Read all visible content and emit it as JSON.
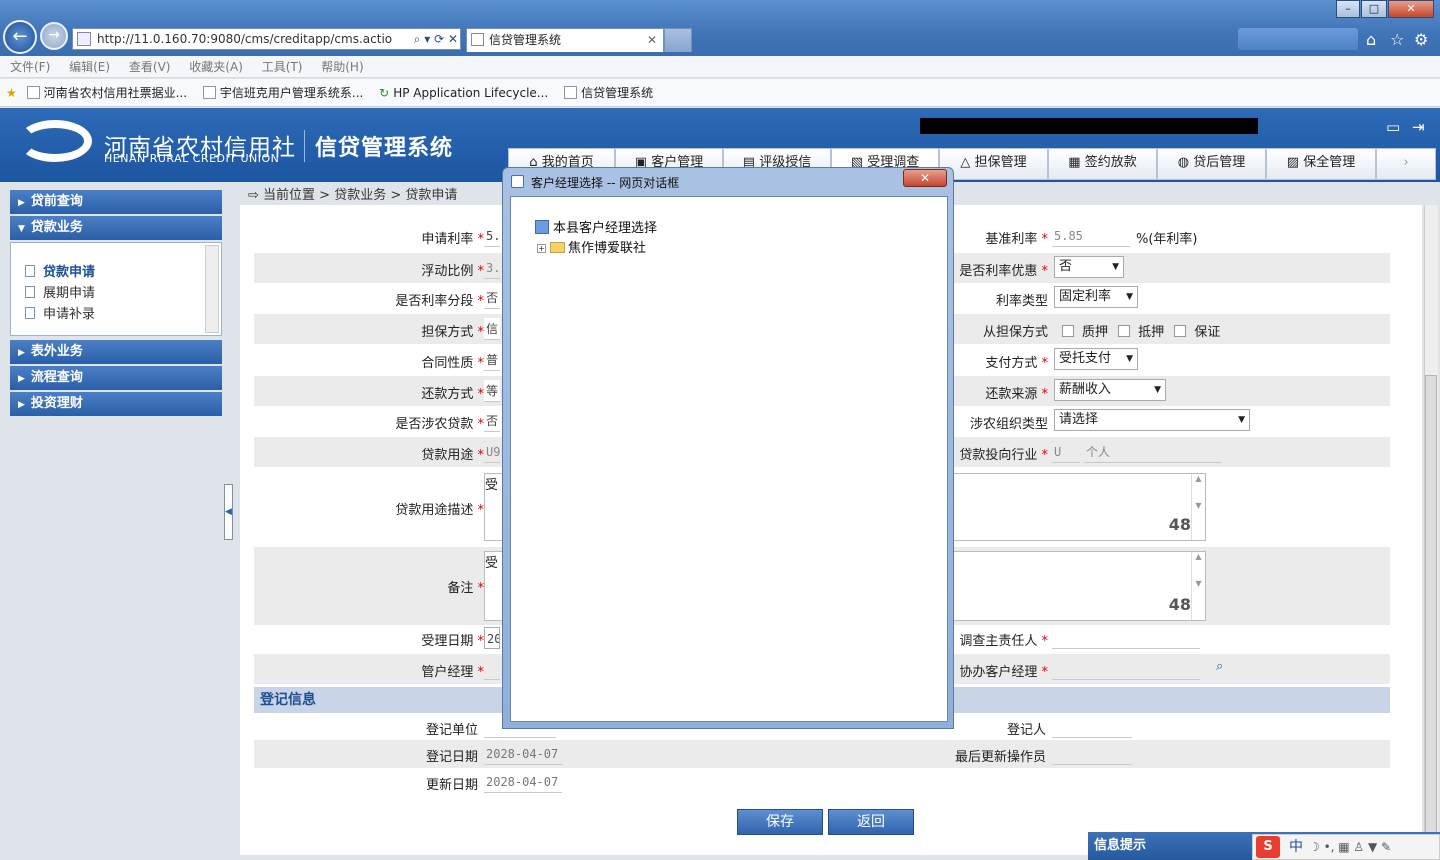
{
  "browser": {
    "address": "http://11.0.160.70:9080/cms/creditapp/cms.actio",
    "tab_title": "信贷管理系统",
    "menu": [
      "文件(F)",
      "编辑(E)",
      "查看(V)",
      "收藏夹(A)",
      "工具(T)",
      "帮助(H)"
    ],
    "favorites": [
      "河南省农村信用社票据业...",
      "宇信班克用户管理系统系...",
      "HP Application Lifecycle...",
      "信贷管理系统"
    ]
  },
  "app": {
    "logo_cn": "河南省农村信用社",
    "logo_en": "HENAN RURAL CREDIT UNION",
    "system_name": "信贷管理系统",
    "nav": [
      "我的首页",
      "客户管理",
      "评级授信",
      "受理调查",
      "担保管理",
      "签约放款",
      "贷后管理",
      "保全管理"
    ],
    "active_nav": "受理调查"
  },
  "sidebar": {
    "sections": [
      "贷前查询",
      "贷款业务",
      "表外业务",
      "流程查询",
      "投资理财"
    ],
    "items": [
      "贷款申请",
      "展期申请",
      "申请补录"
    ]
  },
  "breadcrumb": "当前位置 > 贷款业务 > 贷款申请",
  "form": {
    "apply_rate_label": "申请利率",
    "apply_rate": "5.",
    "base_rate_label": "基准利率",
    "base_rate": "5.85",
    "base_rate_unit": "%(年利率)",
    "float_ratio_label": "浮动比例",
    "float_ratio": "3.",
    "rate_discount_label": "是否利率优惠",
    "rate_discount": "否",
    "rate_segment_label": "是否利率分段",
    "rate_segment": "否",
    "rate_type_label": "利率类型",
    "rate_type": "固定利率",
    "guarantee_label": "担保方式",
    "guarantee": "信",
    "sub_guarantee_label": "从担保方式",
    "sub_guarantee_options": [
      "质押",
      "抵押",
      "保证"
    ],
    "contract_label": "合同性质",
    "contract": "普",
    "payment_label": "支付方式",
    "payment": "受托支付",
    "repay_label": "还款方式",
    "repay": "等",
    "repay_source_label": "还款来源",
    "repay_source": "薪酬收入",
    "agri_label": "是否涉农贷款",
    "agri": "否",
    "agri_org_label": "涉农组织类型",
    "agri_org": "请选择",
    "purpose_label": "贷款用途",
    "purpose": "U9",
    "industry_label": "贷款投向行业",
    "industry_code": "U",
    "industry_name": "个人",
    "purpose_desc_label": "贷款用途描述",
    "purpose_desc": "受",
    "purpose_desc_count": "48",
    "remark_label": "备注",
    "remark": "受",
    "remark_count": "48",
    "accept_date_label": "受理日期",
    "accept_date": "20",
    "investigator_label": "调查主责任人",
    "manager_label": "管户经理",
    "co_manager_label": "协办客户经理"
  },
  "register": {
    "section_title": "登记信息",
    "unit_label": "登记单位",
    "person_label": "登记人",
    "date_label": "登记日期",
    "date": "2028-04-07",
    "last_operator_label": "最后更新操作员",
    "update_label": "更新日期",
    "update_date": "2028-04-07"
  },
  "buttons": {
    "save": "保存",
    "back": "返回"
  },
  "tray": {
    "title": "信息提示",
    "ime": "中"
  },
  "dialog": {
    "title": "客户经理选择 -- 网页对话框",
    "tree_root": "本县客户经理选择",
    "tree_child": "焦作博爱联社"
  },
  "colors": {
    "header_blue": "#1d56a1",
    "required": "#d00",
    "section_bg": "#c9d4e6"
  }
}
